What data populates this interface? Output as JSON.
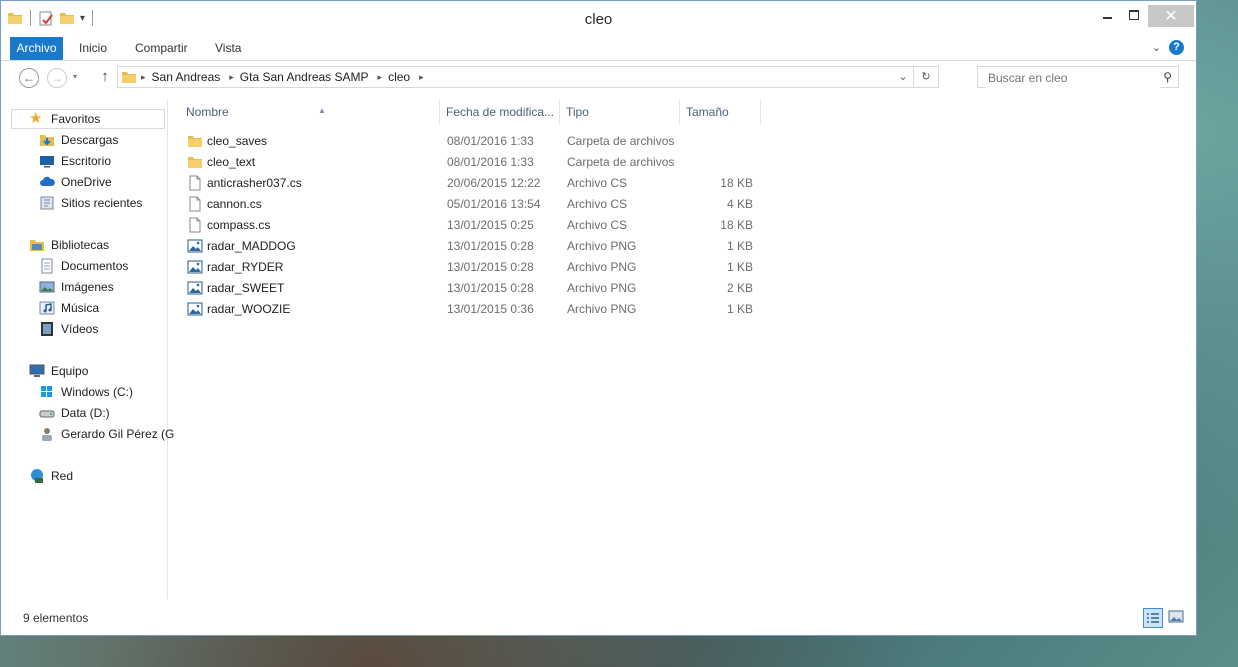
{
  "window": {
    "title": "cleo"
  },
  "ribbon": {
    "tabs": [
      "Archivo",
      "Inicio",
      "Compartir",
      "Vista"
    ]
  },
  "address": {
    "crumbs": [
      "San Andreas",
      "Gta San Andreas SAMP",
      "cleo"
    ]
  },
  "search": {
    "placeholder": "Buscar en cleo"
  },
  "nav": {
    "favorites": [
      "Favoritos",
      "Descargas",
      "Escritorio",
      "OneDrive",
      "Sitios recientes"
    ],
    "libraries": [
      "Bibliotecas",
      "Documentos",
      "Imágenes",
      "Música",
      "Vídeos"
    ],
    "computer": [
      "Equipo",
      "Windows (C:)",
      "Data (D:)",
      "Gerardo Gil Pérez (G"
    ],
    "network": [
      "Red"
    ]
  },
  "columns": [
    "Nombre",
    "Fecha de modifica...",
    "Tipo",
    "Tamaño"
  ],
  "files": [
    {
      "name": "cleo_saves",
      "date": "08/01/2016 1:33",
      "type": "Carpeta de archivos",
      "size": "",
      "icon": "folder-icon"
    },
    {
      "name": "cleo_text",
      "date": "08/01/2016 1:33",
      "type": "Carpeta de archivos",
      "size": "",
      "icon": "folder-icon"
    },
    {
      "name": "anticrasher037.cs",
      "date": "20/06/2015 12:22",
      "type": "Archivo CS",
      "size": "18 KB",
      "icon": "file-icon"
    },
    {
      "name": "cannon.cs",
      "date": "05/01/2016 13:54",
      "type": "Archivo CS",
      "size": "4 KB",
      "icon": "file-icon"
    },
    {
      "name": "compass.cs",
      "date": "13/01/2015 0:25",
      "type": "Archivo CS",
      "size": "18 KB",
      "icon": "file-icon"
    },
    {
      "name": "radar_MADDOG",
      "date": "13/01/2015 0:28",
      "type": "Archivo PNG",
      "size": "1 KB",
      "icon": "image-icon"
    },
    {
      "name": "radar_RYDER",
      "date": "13/01/2015 0:28",
      "type": "Archivo PNG",
      "size": "1 KB",
      "icon": "image-icon"
    },
    {
      "name": "radar_SWEET",
      "date": "13/01/2015 0:28",
      "type": "Archivo PNG",
      "size": "2 KB",
      "icon": "image-icon"
    },
    {
      "name": "radar_WOOZIE",
      "date": "13/01/2015 0:36",
      "type": "Archivo PNG",
      "size": "1 KB",
      "icon": "image-icon"
    }
  ],
  "status": {
    "count": "9 elementos"
  },
  "colors": {
    "accent": "#1979ca",
    "folder": "#e8bd4d",
    "header_text": "#4c607a"
  }
}
